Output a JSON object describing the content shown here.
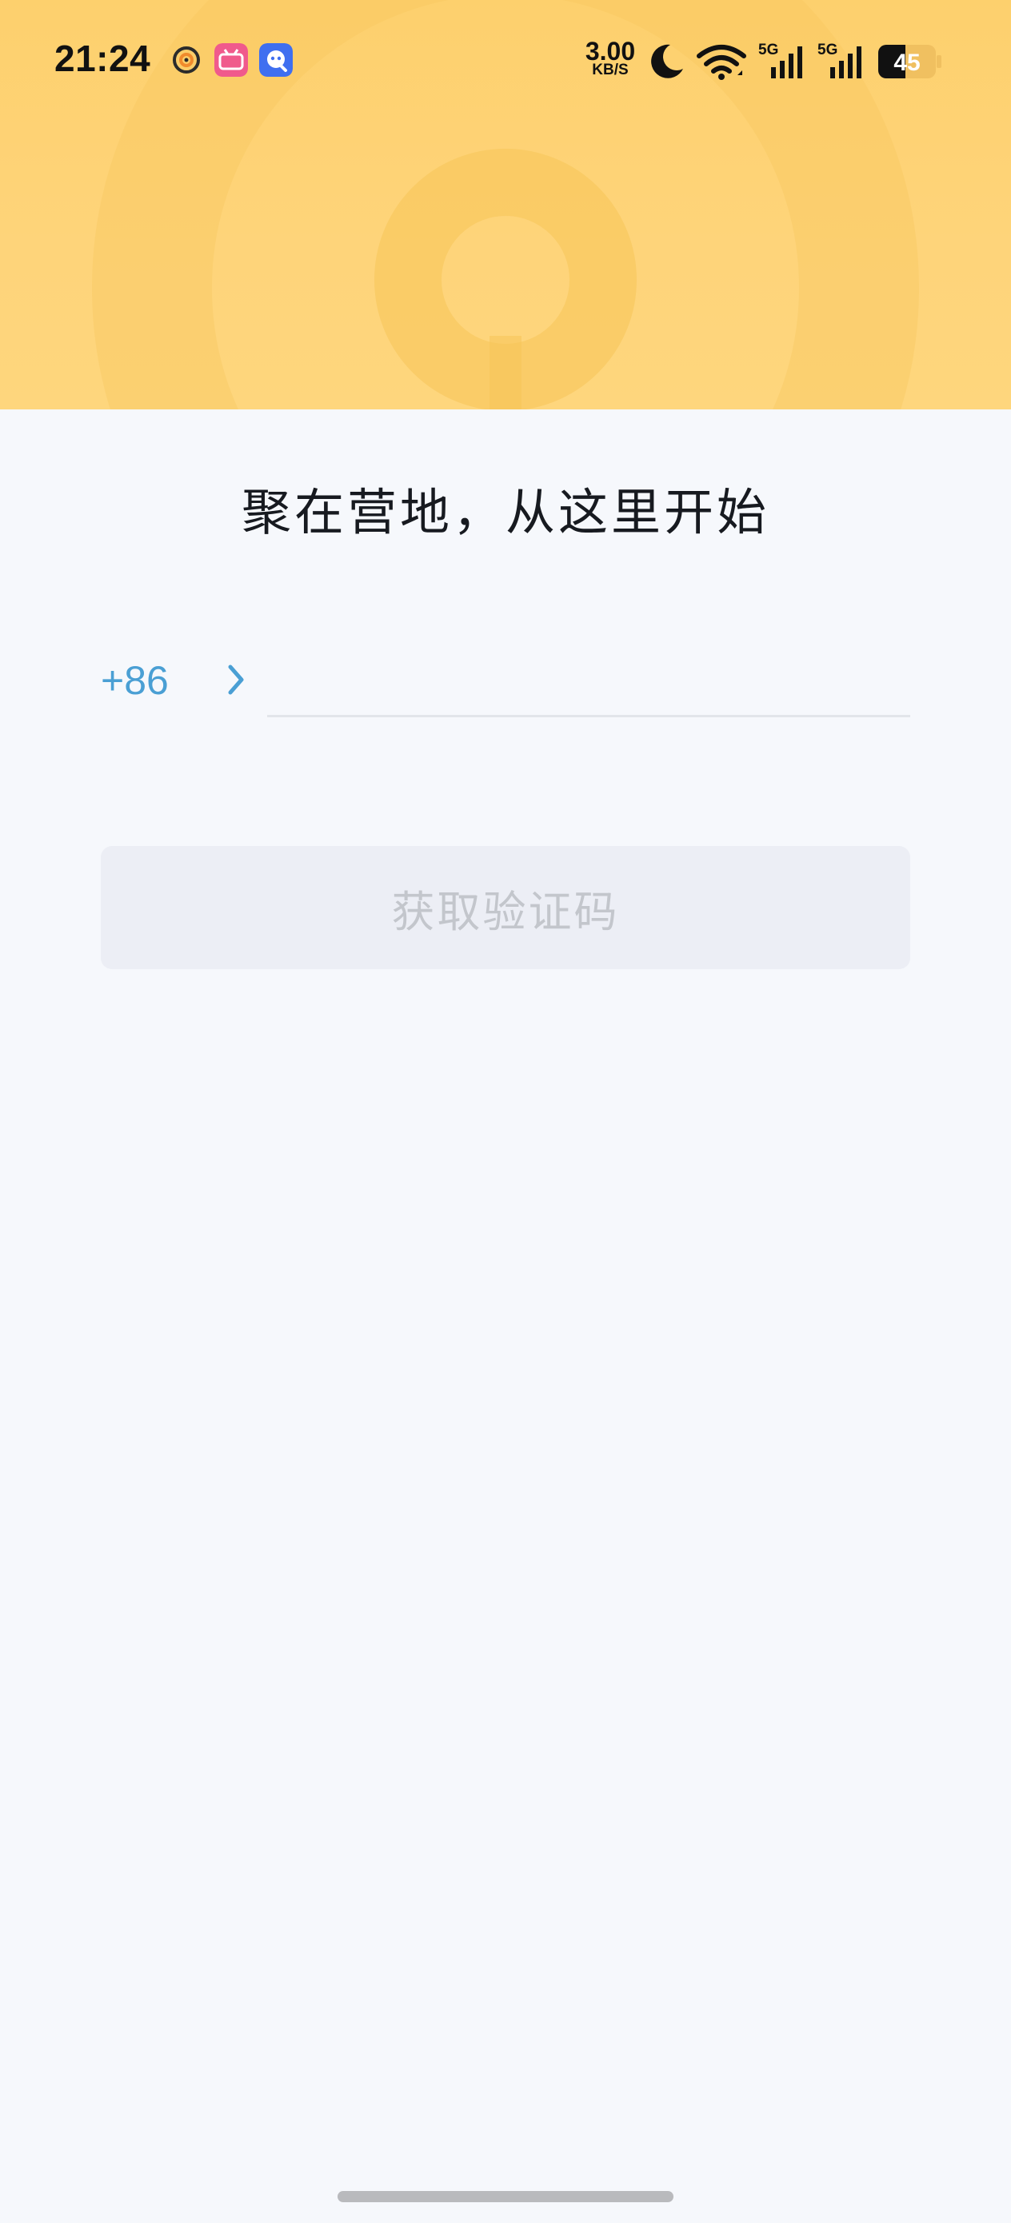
{
  "status_bar": {
    "time": "21:24",
    "app_icons": [
      "target-app-icon",
      "bilibili-icon",
      "qq-channel-icon"
    ],
    "net_speed_value": "3.00",
    "net_speed_unit": "KB/S",
    "icons": [
      "moon-icon",
      "wifi-icon",
      "signal-5g-icon",
      "signal-5g-icon"
    ],
    "sim1_label": "5G",
    "sim2_label": "5G",
    "battery_level": "45"
  },
  "header": {
    "accent_color": "#fdd06d"
  },
  "main": {
    "headline": "聚在营地，从这里开始",
    "country_code": "+86",
    "phone_input_value": "",
    "phone_input_placeholder": "",
    "get_code_button": "获取验证码",
    "link_color": "#4a9fd4"
  }
}
